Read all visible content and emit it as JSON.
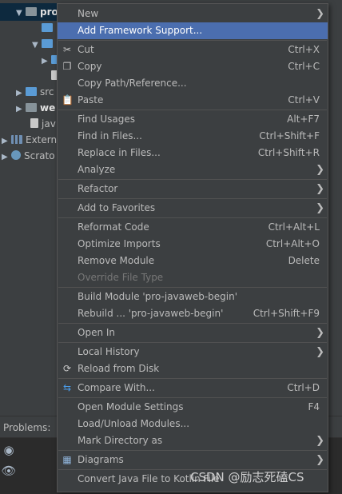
{
  "tree": {
    "root_label": "pro",
    "items": [
      {
        "label": "src"
      },
      {
        "label": "we"
      },
      {
        "label": "jav"
      },
      {
        "label": "Extern"
      },
      {
        "label": "Scrato"
      }
    ]
  },
  "problems": {
    "tab_label": "Problems:"
  },
  "menu": {
    "items": [
      {
        "label": "New",
        "shortcut": "",
        "submenu": true
      },
      {
        "label": "Add Framework Support...",
        "shortcut": "",
        "highlighted": true
      },
      {
        "label": "Cut",
        "shortcut": "Ctrl+X",
        "icon": "scissors-icon"
      },
      {
        "label": "Copy",
        "shortcut": "Ctrl+C",
        "icon": "copy-icon"
      },
      {
        "label": "Copy Path/Reference...",
        "shortcut": ""
      },
      {
        "label": "Paste",
        "shortcut": "Ctrl+V",
        "icon": "clipboard-icon"
      },
      {
        "label": "Find Usages",
        "shortcut": "Alt+F7"
      },
      {
        "label": "Find in Files...",
        "shortcut": "Ctrl+Shift+F"
      },
      {
        "label": "Replace in Files...",
        "shortcut": "Ctrl+Shift+R"
      },
      {
        "label": "Analyze",
        "shortcut": "",
        "submenu": true
      },
      {
        "label": "Refactor",
        "shortcut": "",
        "submenu": true
      },
      {
        "label": "Add to Favorites",
        "shortcut": "",
        "submenu": true
      },
      {
        "label": "Reformat Code",
        "shortcut": "Ctrl+Alt+L"
      },
      {
        "label": "Optimize Imports",
        "shortcut": "Ctrl+Alt+O"
      },
      {
        "label": "Remove Module",
        "shortcut": "Delete"
      },
      {
        "label": "Override File Type",
        "shortcut": "",
        "disabled": true
      },
      {
        "label": "Build Module 'pro-javaweb-begin'",
        "shortcut": ""
      },
      {
        "label": "Rebuild ... 'pro-javaweb-begin'",
        "shortcut": "Ctrl+Shift+F9"
      },
      {
        "label": "Open In",
        "shortcut": "",
        "submenu": true
      },
      {
        "label": "Local History",
        "shortcut": "",
        "submenu": true
      },
      {
        "label": "Reload from Disk",
        "shortcut": "",
        "icon": "reload-icon"
      },
      {
        "label": "Compare With...",
        "shortcut": "Ctrl+D",
        "icon": "compare-icon"
      },
      {
        "label": "Open Module Settings",
        "shortcut": "F4"
      },
      {
        "label": "Load/Unload Modules...",
        "shortcut": ""
      },
      {
        "label": "Mark Directory as",
        "shortcut": "",
        "submenu": true
      },
      {
        "label": "Diagrams",
        "shortcut": "",
        "submenu": true,
        "icon": "diagram-icon"
      },
      {
        "label": "Convert Java File to Kotlin File",
        "shortcut": ""
      }
    ]
  },
  "watermark": "CSDN @励志死磕CS"
}
